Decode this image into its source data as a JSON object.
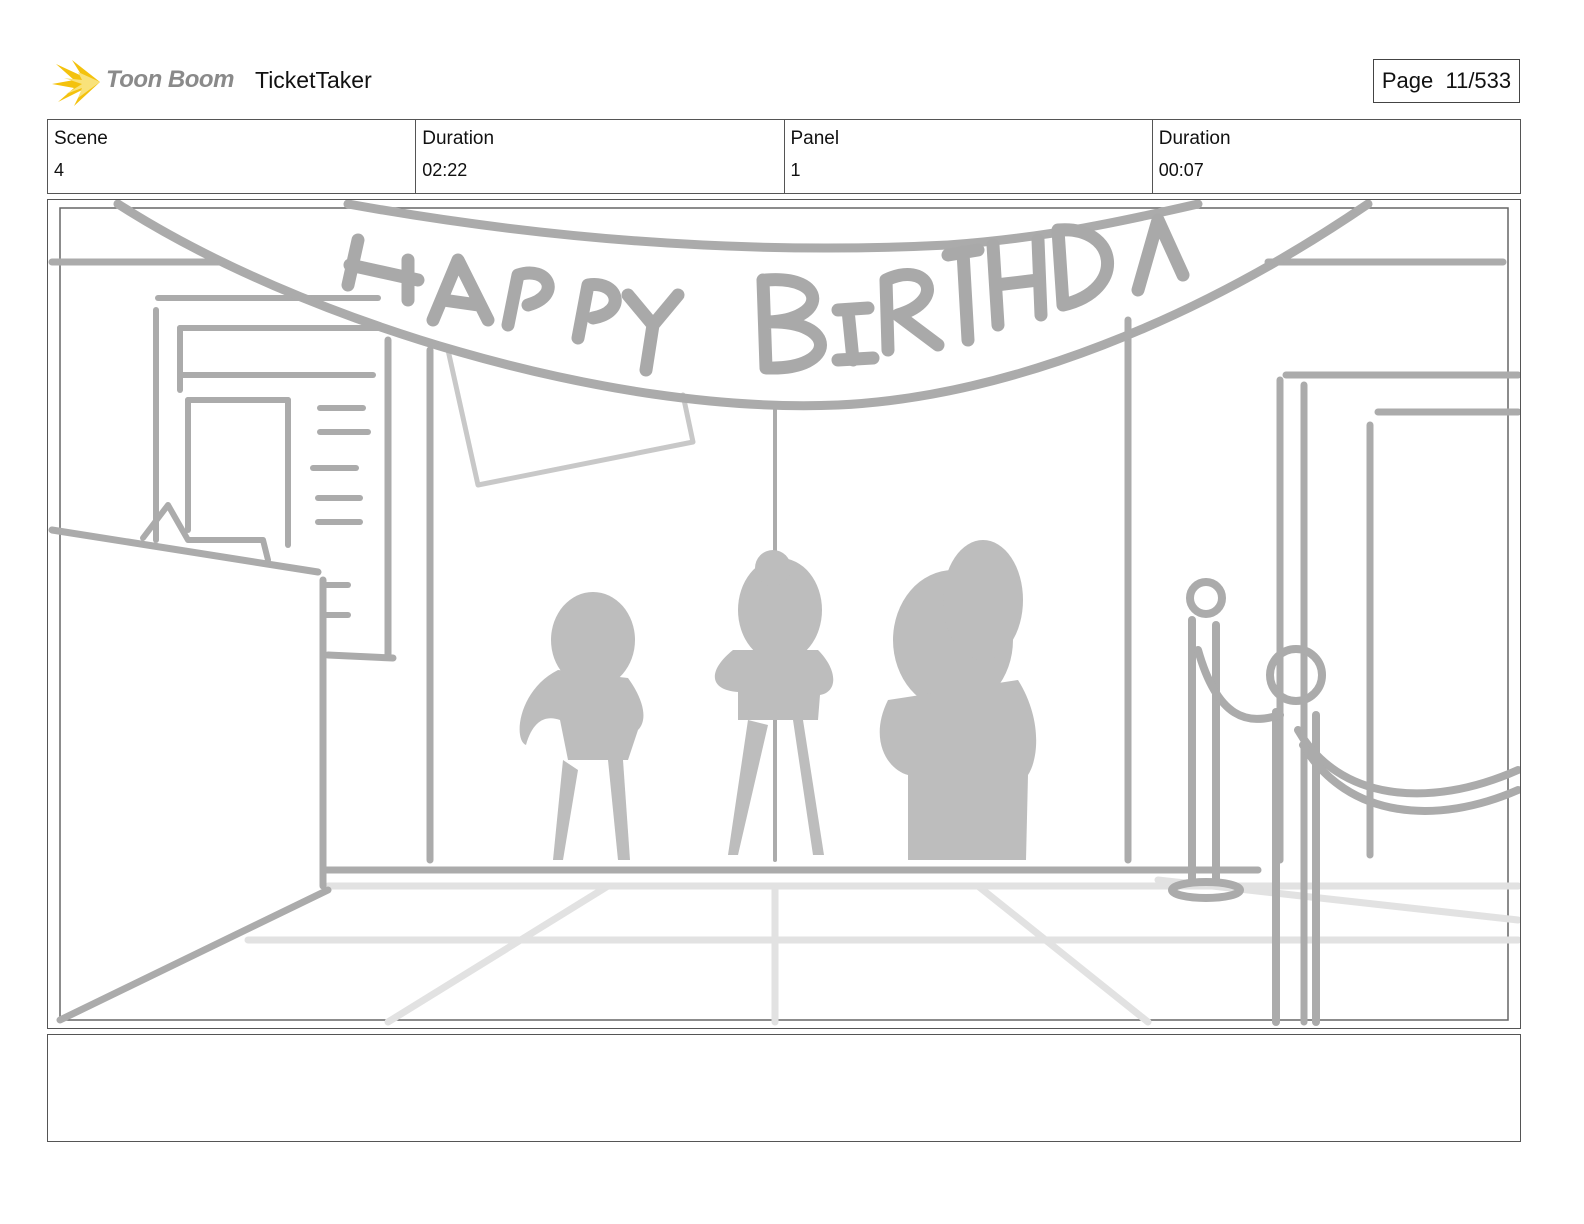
{
  "header": {
    "brand": "Toon Boom",
    "project_name": "TicketTaker",
    "page_label": "Page",
    "page_value": "11/533"
  },
  "info": [
    {
      "label": "Scene",
      "value": "4"
    },
    {
      "label": "Duration",
      "value": "02:22"
    },
    {
      "label": "Panel",
      "value": "1"
    },
    {
      "label": "Duration",
      "value": "00:07"
    }
  ],
  "panel": {
    "banner_text": "HAPPY BIRTHDAY"
  },
  "notes": {
    "text": ""
  }
}
